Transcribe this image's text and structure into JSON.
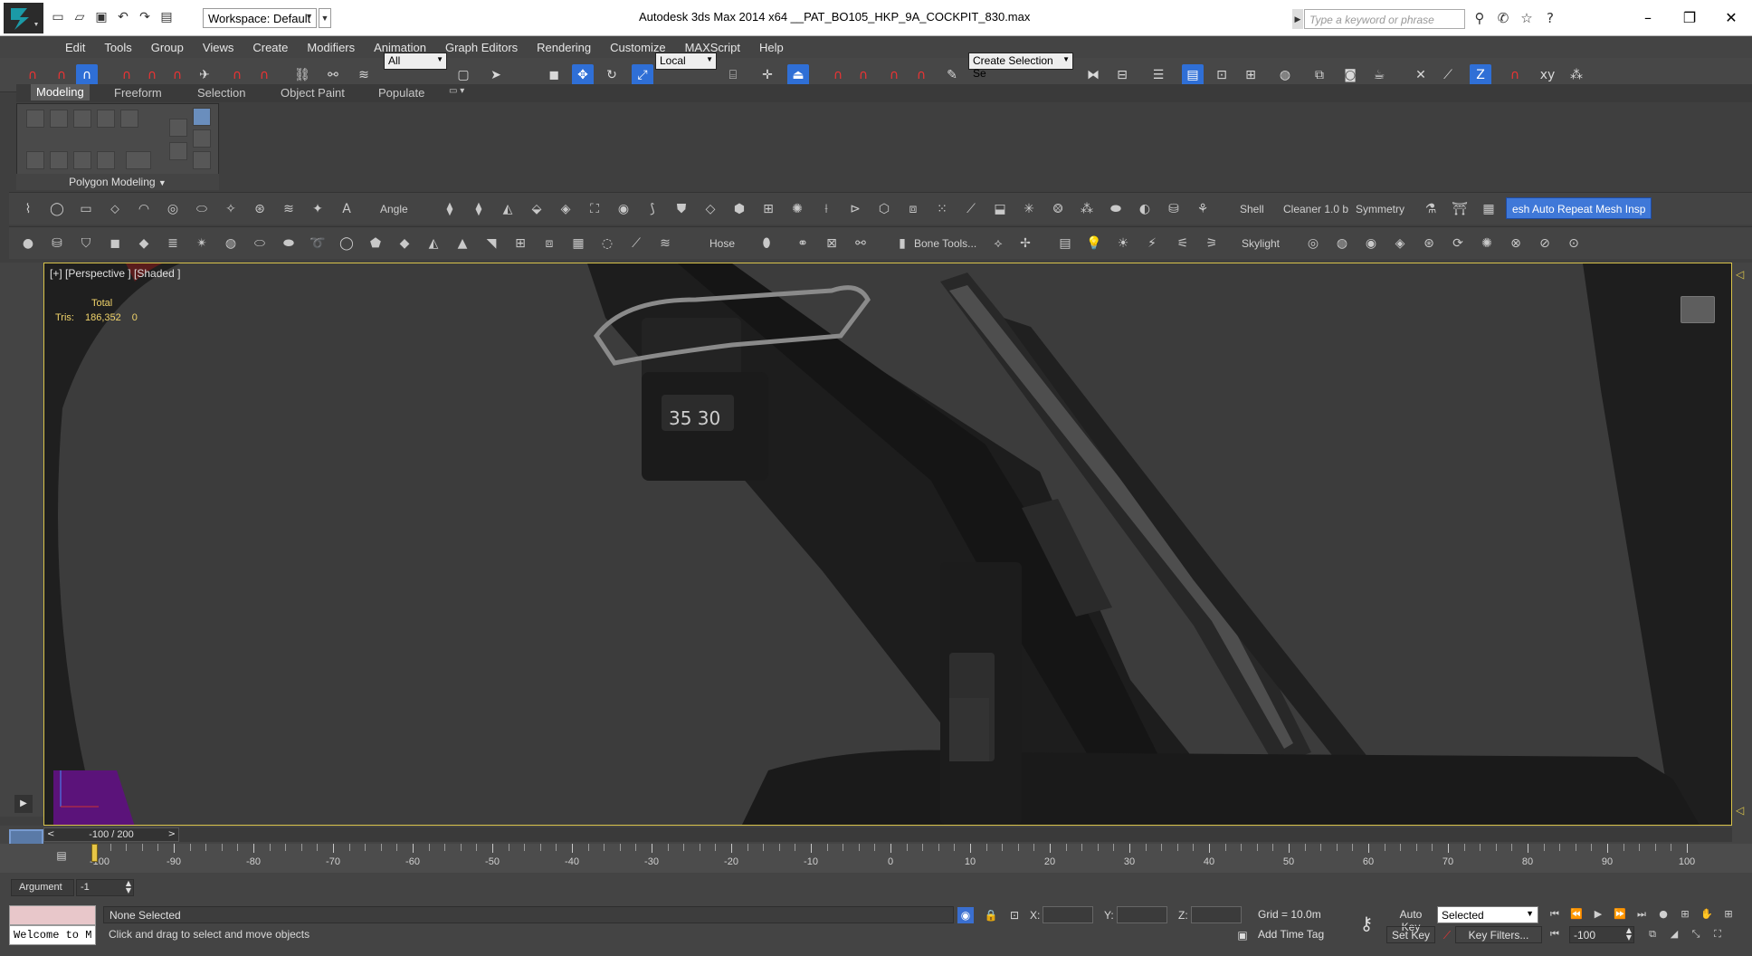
{
  "app": {
    "title": "Autodesk 3ds Max  2014 x64     __PAT_BO105_HKP_9A_COCKPIT_830.max",
    "workspace": "Workspace: Default",
    "search_placeholder": "Type a keyword or phrase"
  },
  "menu": [
    "Edit",
    "Tools",
    "Group",
    "Views",
    "Create",
    "Modifiers",
    "Animation",
    "Graph Editors",
    "Rendering",
    "Customize",
    "MAXScript",
    "Help"
  ],
  "toolbar": {
    "selection_filter": "All",
    "ref_coord": "Local",
    "named_selection": "Create Selection Se"
  },
  "ribbon": {
    "tabs": [
      "Modeling",
      "Freeform",
      "Selection",
      "Object Paint",
      "Populate"
    ],
    "active_tab": "Modeling",
    "panel_label": "Polygon Modeling"
  },
  "shelf1": {
    "angle": "Angle",
    "shell": "Shell",
    "cleaner": "Cleaner 1.0 b",
    "symmetry": "Symmetry",
    "mesh_auto_repeat": "esh Auto Repeat Mesh Insp"
  },
  "shelf2": {
    "hose": "Hose",
    "bone_tools": "Bone Tools...",
    "skylight": "Skylight"
  },
  "viewport": {
    "label": "[+] [Perspective ] [Shaded ]",
    "stats_header": "Total",
    "stats_label": "Tris:",
    "stats_total": "186,352",
    "stats_selected": "0",
    "compass_text": "35  30"
  },
  "time_slider": {
    "label": "-100 / 200",
    "position_fraction": 0.0
  },
  "timeline": {
    "ticks": [
      -90,
      -80,
      -70,
      -60,
      -50,
      -40,
      -30,
      -20,
      -10,
      0,
      10,
      20,
      30,
      40,
      50,
      60,
      70,
      80,
      90,
      100
    ],
    "start_label": "-100",
    "end": 100,
    "current_frame": -100
  },
  "status": {
    "argument_label": "Argument",
    "argument_value": "-1",
    "listener_text": "Welcome to M",
    "selection": "None Selected",
    "prompt": "Click and drag to select and move objects",
    "x_label": "X:",
    "y_label": "Y:",
    "z_label": "Z:",
    "grid": "Grid = 10.0m",
    "add_time_tag": "Add Time Tag",
    "auto_key": "Auto Key",
    "set_key": "Set Key",
    "key_mode": "Selected",
    "key_filters": "Key Filters...",
    "current_frame_box": "-100"
  },
  "colors": {
    "accent_blue": "#3f78d8",
    "viewport_border": "#d9c34a",
    "stats_yellow": "#f0d36a",
    "time_cursor": "#e7c646"
  }
}
